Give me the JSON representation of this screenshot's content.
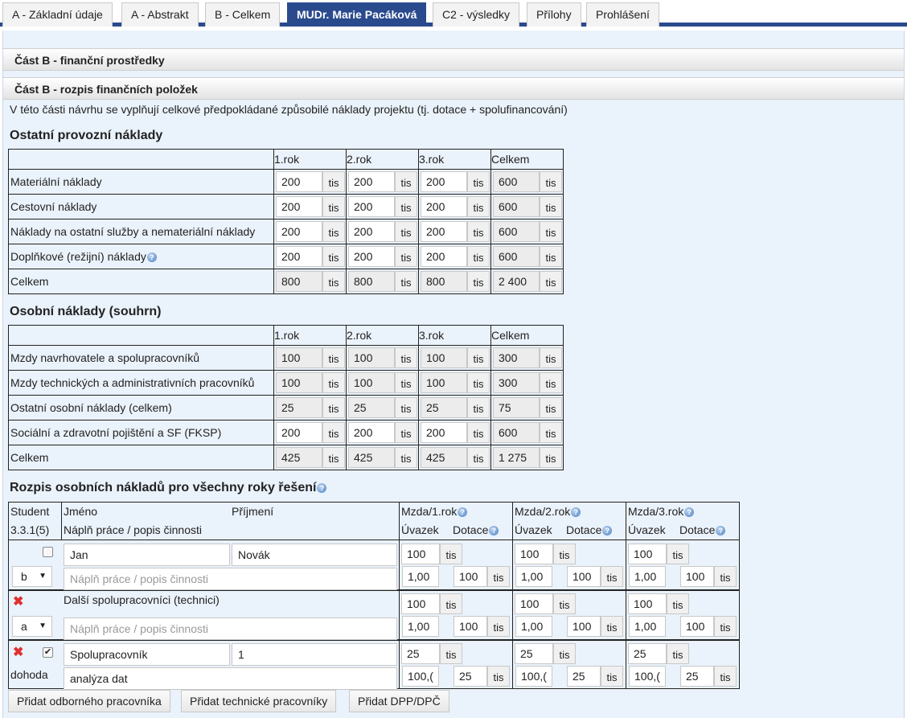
{
  "tabs": [
    "A - Základní údaje",
    "A - Abstrakt",
    "B - Celkem",
    "MUDr. Marie Pacáková",
    "C2 - výsledky",
    "Přílohy",
    "Prohlášení"
  ],
  "sections": {
    "financni": "Část B - finanční prostředky",
    "rozpis": "Část B - rozpis finančních položek",
    "intro": "V této části návrhu se vyplňují celkové předpokládané způsobilé náklady projektu (tj. dotace + spolufinancování)"
  },
  "unit": "tis",
  "help_glyph": "?",
  "provozni": {
    "title": "Ostatní provozní náklady",
    "headers": [
      "1.rok",
      "2.rok",
      "3.rok",
      "Celkem"
    ],
    "rows": [
      {
        "label": "Materiální náklady",
        "values": [
          "200",
          "200",
          "200",
          "600"
        ]
      },
      {
        "label": "Cestovní náklady",
        "values": [
          "200",
          "200",
          "200",
          "600"
        ]
      },
      {
        "label": "Náklady na ostatní služby a nemateriální náklady",
        "values": [
          "200",
          "200",
          "200",
          "600"
        ]
      },
      {
        "label": "Doplňkové (režijní) náklady",
        "values": [
          "200",
          "200",
          "200",
          "600"
        ]
      },
      {
        "label": "Celkem",
        "values": [
          "800",
          "800",
          "800",
          "2 400"
        ]
      }
    ]
  },
  "osobni": {
    "title": "Osobní náklady (souhrn)",
    "headers": [
      "1.rok",
      "2.rok",
      "3.rok",
      "Celkem"
    ],
    "rows": [
      {
        "label": "Mzdy navrhovatele a spolupracovníků",
        "values": [
          "100",
          "100",
          "100",
          "300"
        ]
      },
      {
        "label": "Mzdy technických a administrativních pracovníků",
        "values": [
          "100",
          "100",
          "100",
          "300"
        ]
      },
      {
        "label": "Ostatní osobní náklady (celkem)",
        "values": [
          "25",
          "25",
          "25",
          "75"
        ]
      },
      {
        "label": "Sociální a zdravotní pojištění a SF (FKSP)",
        "values": [
          "200",
          "200",
          "200",
          "600"
        ]
      },
      {
        "label": "Celkem",
        "values": [
          "425",
          "425",
          "425",
          "1 275"
        ]
      }
    ]
  },
  "rozpis": {
    "title": "Rozpis osobních nákladů pro všechny roky řešení",
    "head": {
      "student": "Student",
      "code": "3.3.1(5)",
      "jmeno": "Jméno",
      "prijmeni": "Příjmení",
      "napln": "Náplň práce / popis činnosti",
      "mzda": [
        "Mzda/1.rok",
        "Mzda/2.rok",
        "Mzda/3.rok"
      ],
      "uvazek": "Úvazek",
      "dotace": "Dotace"
    },
    "rows": [
      {
        "select": "b",
        "jmeno": "Jan",
        "prijmeni": "Novák",
        "napln_placeholder": "Náplň práce / popis činnosti",
        "mzda": [
          "100",
          "100",
          "100"
        ],
        "uvazek": [
          "1,00",
          "1,00",
          "1,00"
        ],
        "dotace": [
          "100",
          "100",
          "100"
        ]
      },
      {
        "select": "a",
        "label": "Další spolupracovníci (technici)",
        "napln_placeholder": "Náplň práce / popis činnosti",
        "mzda": [
          "100",
          "100",
          "100"
        ],
        "uvazek": [
          "1,00",
          "1,00",
          "1,00"
        ],
        "dotace": [
          "100",
          "100",
          "100"
        ]
      },
      {
        "type": "dohoda",
        "jmeno": "Spolupracovník",
        "prijmeni": "1",
        "napln": "analýza dat",
        "mzda": [
          "25",
          "25",
          "25"
        ],
        "uvazek": [
          "100,(",
          "100,(",
          "100,("
        ],
        "dotace": [
          "25",
          "25",
          "25"
        ]
      }
    ]
  },
  "buttons": [
    "Přidat odborného pracovníka",
    "Přidat technické pracovníky",
    "Přidat DPP/DPČ"
  ]
}
